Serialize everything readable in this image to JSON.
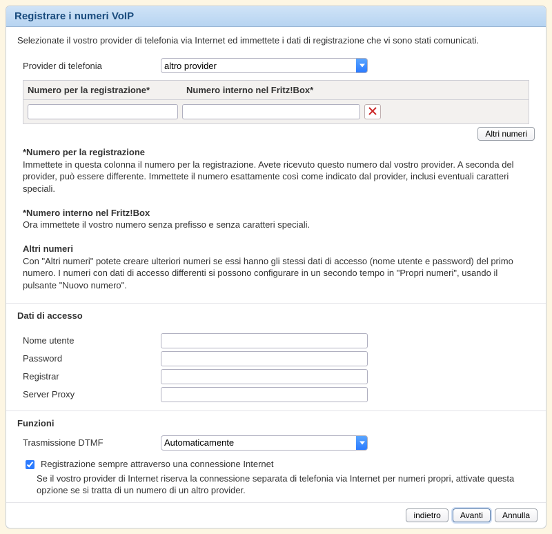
{
  "header": {
    "title": "Registrare i numeri VoIP"
  },
  "intro": "Selezionate il vostro provider di telefonia via Internet ed immettete i dati di registrazione che vi sono stati comunicati.",
  "provider": {
    "label": "Provider di telefonia",
    "selected": "altro provider"
  },
  "numbers": {
    "col1": "Numero per la registrazione*",
    "col2": "Numero interno nel Fritz!Box*",
    "row": {
      "reg": "",
      "intern": ""
    },
    "more_btn": "Altri numeri"
  },
  "help": {
    "reg_t": "*Numero per la registrazione",
    "reg_b": "Immettete in questa colonna il numero per la registrazione. Avete ricevuto questo numero dal vostro provider. A seconda del provider, può essere differente. Immettete il numero esattamente così come indicato dal provider, inclusi eventuali caratteri speciali.",
    "int_t": "*Numero interno nel Fritz!Box",
    "int_b": "Ora immettete il vostro numero senza prefisso e senza caratteri speciali.",
    "more_t": "Altri numeri",
    "more_b": "Con \"Altri numeri\" potete creare ulteriori numeri se essi hanno gli stessi dati di accesso (nome utente e password) del primo numero. I numeri con dati di accesso differenti si possono configurare in un secondo tempo in \"Propri numeri\", usando il pulsante \"Nuovo numero\"."
  },
  "access": {
    "title": "Dati di accesso",
    "user_l": "Nome utente",
    "user_v": "",
    "pass_l": "Password",
    "pass_v": "",
    "reg_l": "Registrar",
    "reg_v": "",
    "proxy_l": "Server Proxy",
    "proxy_v": ""
  },
  "functions": {
    "title": "Funzioni",
    "dtmf_l": "Trasmissione DTMF",
    "dtmf_selected": "Automaticamente",
    "chk_checked": true,
    "chk_label": "Registrazione sempre attraverso una connessione Internet",
    "chk_sub": "Se il vostro provider di Internet riserva la connessione separata di telefonia via Internet per numeri propri, attivate questa opzione se si tratta di un numero di un altro provider."
  },
  "footer": {
    "back": "indietro",
    "next": "Avanti",
    "cancel": "Annulla"
  }
}
